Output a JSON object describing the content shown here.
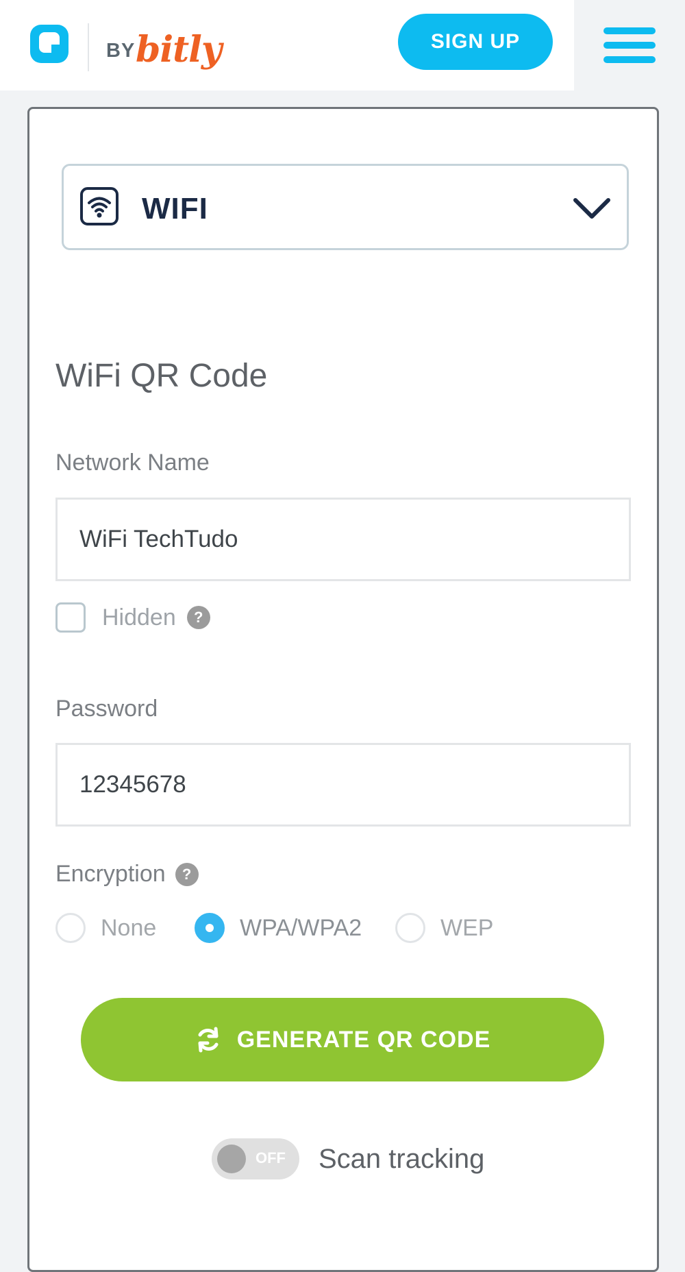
{
  "header": {
    "logo_by": "BY",
    "logo_brand": "bitly",
    "signup_label": "SIGN UP",
    "menu_icon": "hamburger-menu-icon"
  },
  "form": {
    "type_selector": {
      "icon": "wifi-icon",
      "value": "WIFI",
      "chevron": "chevron-down-icon"
    },
    "title": "WiFi QR Code",
    "network_name": {
      "label": "Network Name",
      "value": "WiFi TechTudo"
    },
    "hidden": {
      "label": "Hidden",
      "checked": false,
      "help": "?"
    },
    "password": {
      "label": "Password",
      "value": "12345678"
    },
    "encryption": {
      "label": "Encryption",
      "help": "?",
      "options": [
        {
          "label": "None",
          "selected": false
        },
        {
          "label": "WPA/WPA2",
          "selected": true
        },
        {
          "label": "WEP",
          "selected": false
        }
      ]
    },
    "generate_label": "GENERATE QR CODE",
    "generate_icon": "refresh-icon",
    "scan_tracking": {
      "state": "OFF",
      "label": "Scan tracking",
      "enabled": false
    }
  },
  "colors": {
    "brand_blue": "#0dbbf0",
    "bitly_orange": "#ee6123",
    "generate_green": "#8fc532",
    "radio_selected": "#35b6f0"
  }
}
